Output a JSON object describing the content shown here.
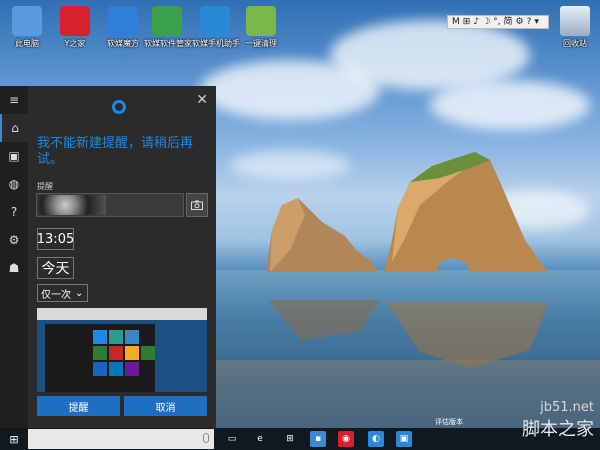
{
  "desktop": {
    "icons": [
      {
        "label": "此电脑",
        "icon": "computer-icon",
        "color": "#5a9be0"
      },
      {
        "label": "Y之家",
        "icon": "ithome-icon",
        "color": "#d8202f"
      },
      {
        "label": "软媒魔方",
        "icon": "mofang-icon",
        "color": "#2f7fd6"
      },
      {
        "label": "软媒软件管家",
        "icon": "software-manager-icon",
        "color": "#3aa04a"
      },
      {
        "label": "软媒手机助手",
        "icon": "phone-assistant-icon",
        "color": "#2a88d8"
      },
      {
        "label": "一键清理",
        "icon": "cleaner-icon",
        "color": "#7ab84a"
      }
    ],
    "recycle_bin_label": "回收站",
    "language_bar": [
      "M",
      "⊞",
      "♪",
      "☽",
      "°,",
      "简",
      "⚙",
      "?",
      "▾"
    ],
    "note": "评估版本"
  },
  "sidebar": {
    "items": [
      {
        "icon": "menu-icon",
        "glyph": "≡"
      },
      {
        "icon": "home-icon",
        "glyph": "⌂"
      },
      {
        "icon": "notebook-icon",
        "glyph": "▣"
      },
      {
        "icon": "lightbulb-icon",
        "glyph": "◍"
      },
      {
        "icon": "help-icon",
        "glyph": "?"
      },
      {
        "icon": "settings-icon",
        "glyph": "⚙"
      },
      {
        "icon": "feedback-icon",
        "glyph": "☗"
      }
    ]
  },
  "cortana": {
    "message": "我不能新建提醒，请稍后再试。",
    "reminder_label": "提醒",
    "time": "13:05",
    "day": "今天",
    "repeat": "仅一次",
    "confirm_label": "提醒",
    "cancel_label": "取消",
    "close_glyph": "✕"
  },
  "taskbar": {
    "search_placeholder": "",
    "start_glyph": "⊞",
    "apps": [
      {
        "icon": "task-view-icon",
        "color": "transparent",
        "glyph": "▭"
      },
      {
        "icon": "edge-icon",
        "color": "transparent",
        "glyph": "e"
      },
      {
        "icon": "store-icon",
        "color": "transparent",
        "glyph": "⊞"
      },
      {
        "icon": "explorer-icon",
        "color": "#3a8ad8",
        "glyph": "▪"
      },
      {
        "icon": "ithome-icon",
        "color": "#d8202f",
        "glyph": "◉"
      },
      {
        "icon": "phone-assistant-icon",
        "color": "#2a88d8",
        "glyph": "◐"
      },
      {
        "icon": "store-tile-icon",
        "color": "#2a88d8",
        "glyph": "▣"
      }
    ]
  },
  "watermark": {
    "line1": "jb51.net",
    "line2": "脚本之家"
  }
}
